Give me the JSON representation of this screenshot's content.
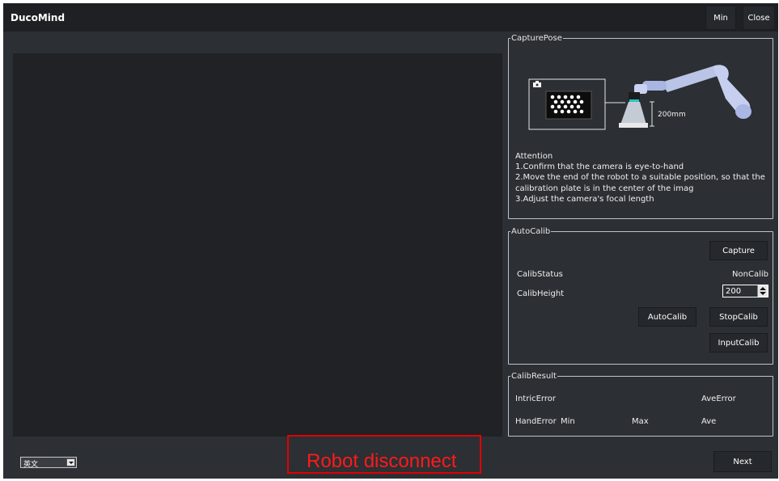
{
  "app": {
    "title": "DucoMind",
    "min_label": "Min",
    "close_label": "Close"
  },
  "capture_pose": {
    "legend": "CapturePose",
    "illustration": {
      "distance_label": "200mm",
      "camera_icon": "camera-icon"
    },
    "attention": {
      "heading": "Attention",
      "lines": [
        "1.Confirm that the camera is eye-to-hand",
        "2.Move the end of the robot to a suitable position, so that the",
        "calibration plate is in the center of the imag",
        "3.Adjust the camera's focal length"
      ]
    }
  },
  "auto_calib": {
    "legend": "AutoCalib",
    "capture_label": "Capture",
    "calib_status_label": "CalibStatus",
    "calib_status_value": "NonCalib",
    "calib_height_label": "CalibHeight",
    "calib_height_value": "200",
    "autocalib_label": "AutoCalib",
    "stopcalib_label": "StopCalib",
    "inputcalib_label": "InputCalib"
  },
  "calib_result": {
    "legend": "CalibResult",
    "intric_error_label": "IntricError",
    "ave_error_label": "AveError",
    "hand_error_label": "HandError",
    "min_label": "Min",
    "max_label": "Max",
    "ave_label": "Ave"
  },
  "footer": {
    "language_value": "英文",
    "status_text": "Robot disconnect",
    "next_label": "Next"
  },
  "colors": {
    "window_bg": "#2c2f33",
    "titlebar_bg": "#1e2023",
    "viewer_bg": "#202226",
    "status_red": "#e20000"
  }
}
